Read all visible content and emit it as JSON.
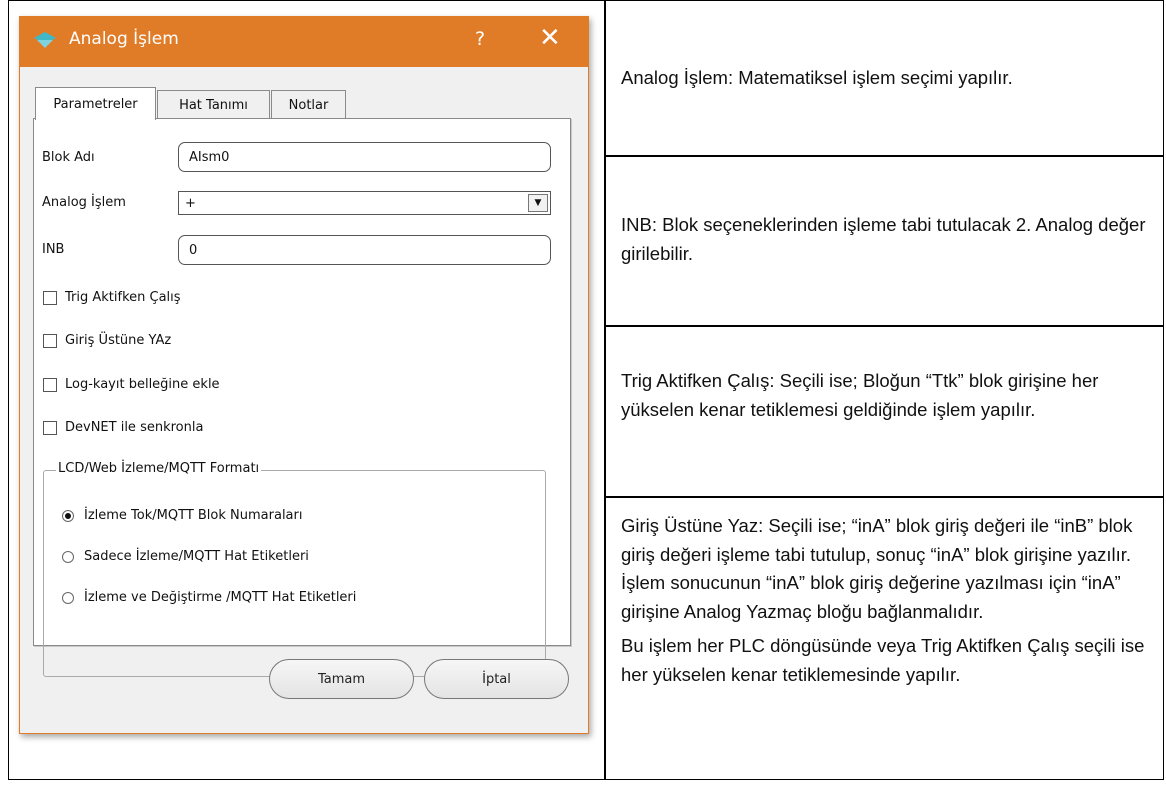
{
  "dialog": {
    "title": "Analog İşlem",
    "help": "?",
    "close": "✕",
    "tabs": [
      "Parametreler",
      "Hat Tanımı",
      "Notlar"
    ],
    "fields": {
      "blok_adi_label": "Blok Adı",
      "blok_adi_value": "AIsm0",
      "analog_islem_label": "Analog İşlem",
      "analog_islem_value": "+",
      "inb_label": "INB",
      "inb_value": "0"
    },
    "checkboxes": [
      "Trig Aktifken Çalış",
      "Giriş Üstüne YAz",
      "Log-kayıt belleğine ekle",
      "DevNET ile senkronla"
    ],
    "group": {
      "title": "LCD/Web İzleme/MQTT Formatı",
      "options": [
        "İzleme Tok/MQTT Blok Numaraları",
        "Sadece İzleme/MQTT Hat Etiketleri",
        "İzleme ve Değiştirme /MQTT Hat Etiketleri"
      ],
      "selected_index": 0
    },
    "buttons": {
      "ok": "Tamam",
      "cancel": "İptal"
    },
    "accent": "#e07b27"
  },
  "descriptions": {
    "row1": "Analog İşlem:  Matematiksel işlem seçimi yapılır.",
    "row2": "INB:  Blok seçeneklerinden işleme tabi tutulacak 2. Analog değer girilebilir.",
    "row3": "Trig Aktifken Çalış:  Seçili ise; Bloğun “Ttk” blok girişine her yükselen kenar tetiklemesi geldiğinde işlem yapılır.",
    "row4_p1": "Giriş Üstüne Yaz:  Seçili ise; “inA” blok giriş değeri ile “inB” blok giriş değeri işleme tabi tutulup, sonuç “inA” blok girişine yazılır. İşlem sonucunun “inA” blok giriş değerine yazılması için “inA” girişine Analog Yazmaç bloğu bağlanmalıdır.",
    "row4_p2": "Bu işlem her PLC döngüsünde veya Trig Aktifken Çalış seçili ise her yükselen kenar tetiklemesinde yapılır."
  }
}
